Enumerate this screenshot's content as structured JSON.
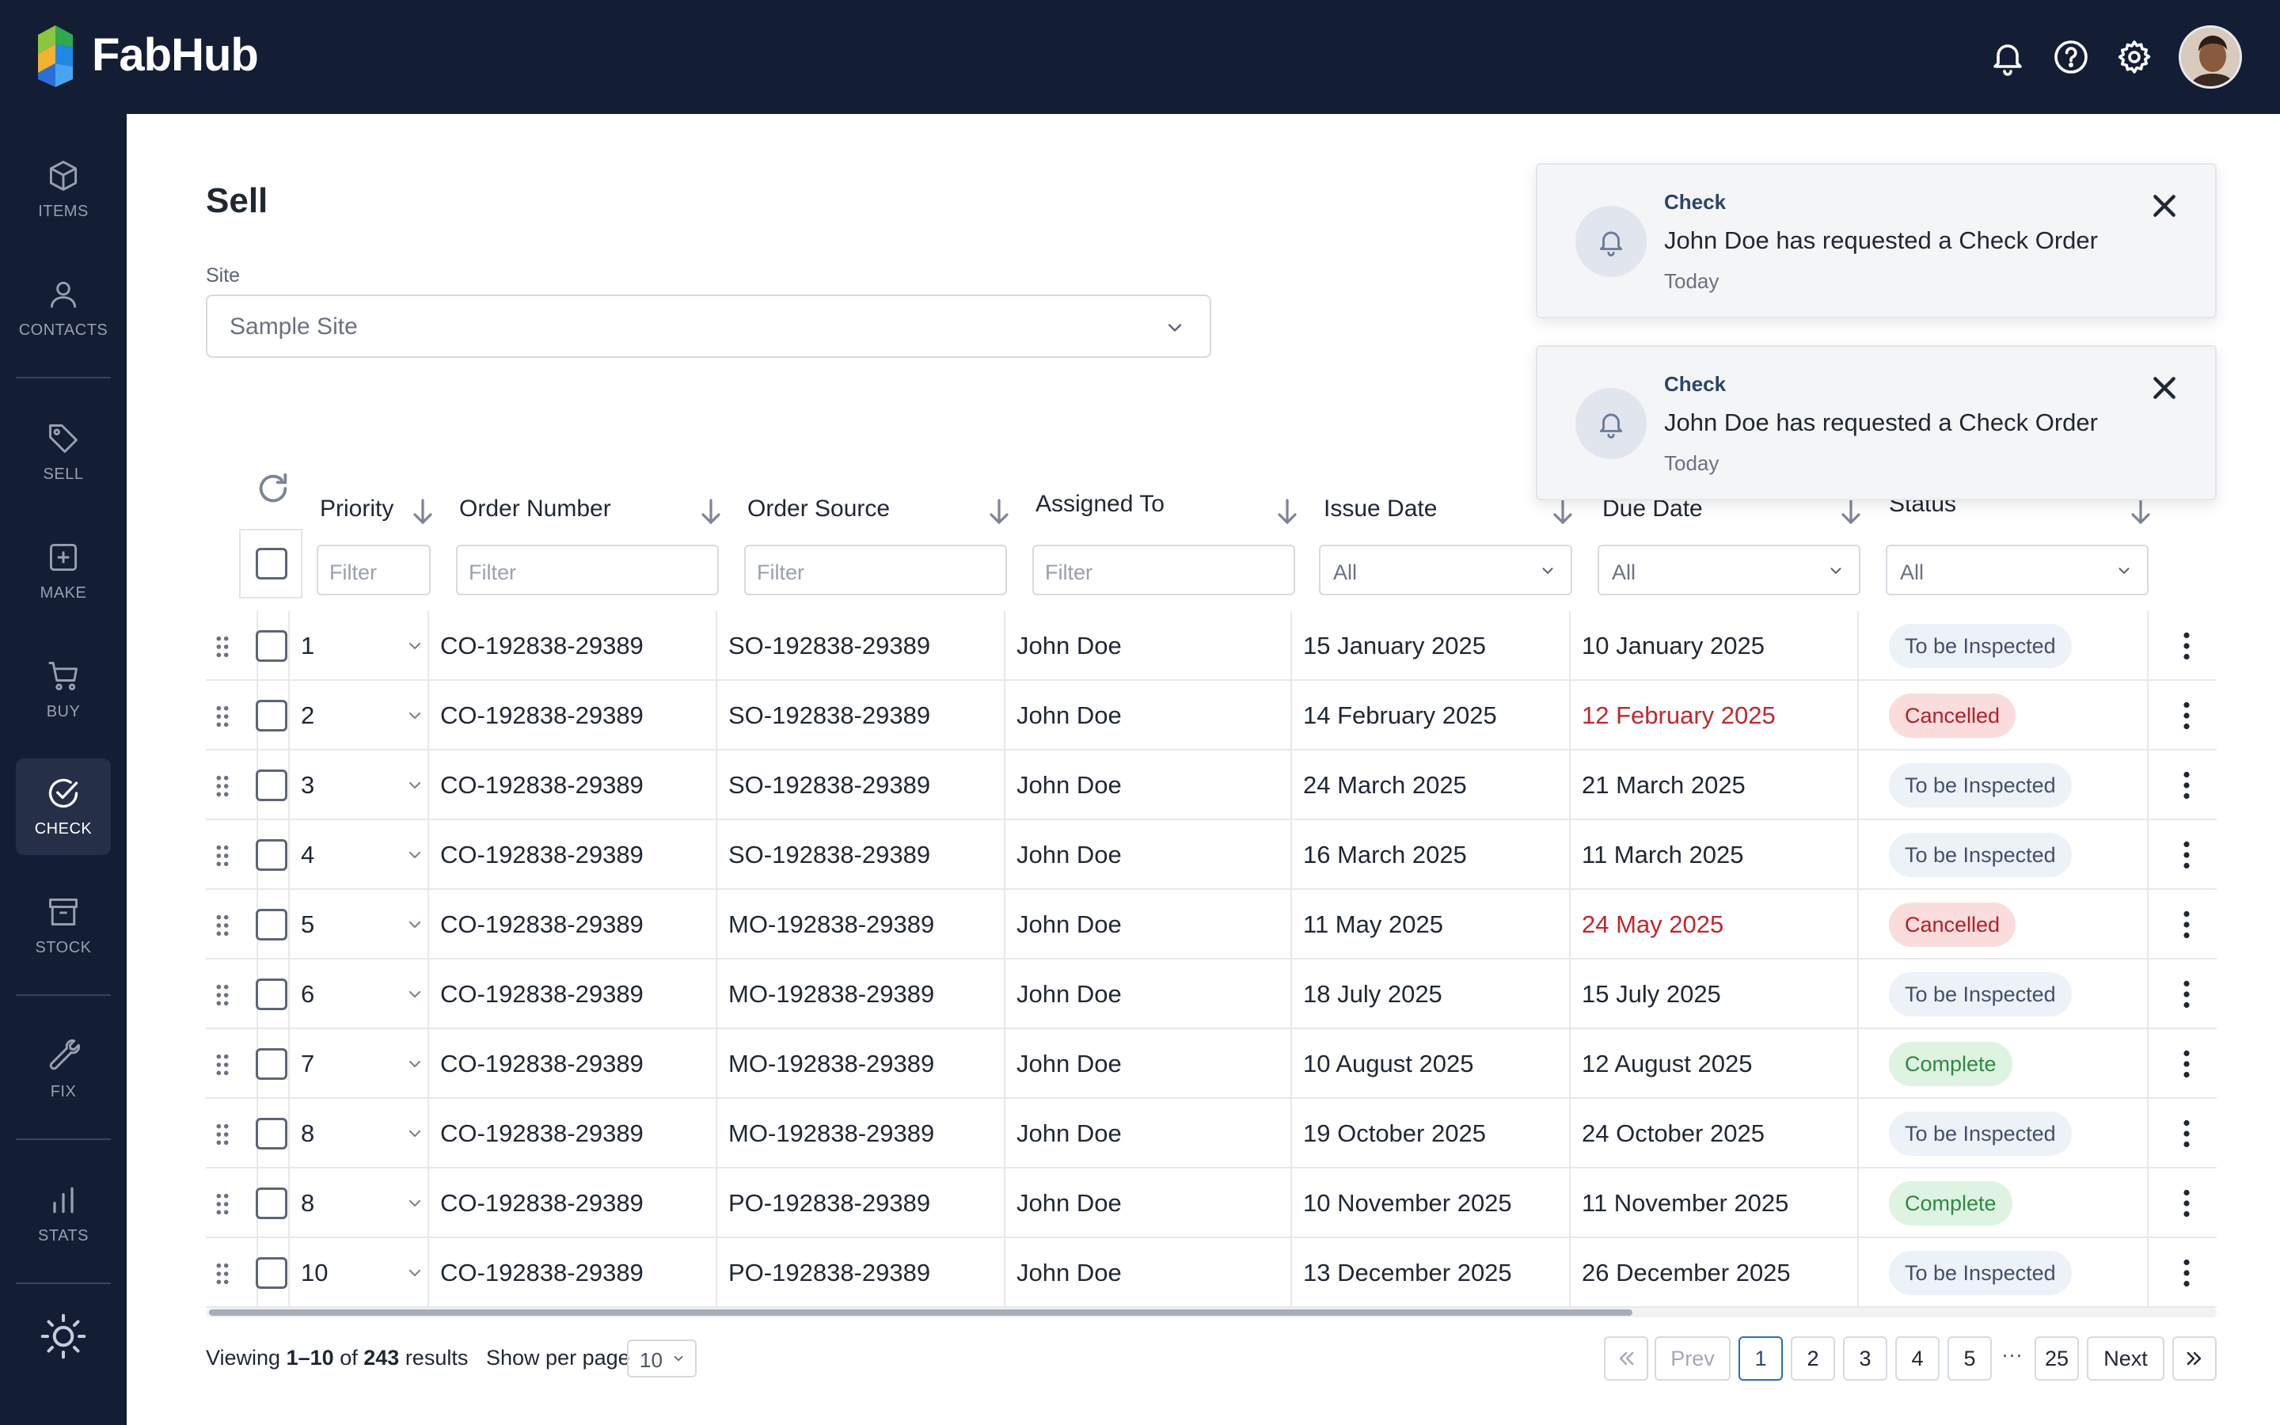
{
  "app": {
    "brand": "FabHub"
  },
  "topbar": {
    "icons": [
      "bell-icon",
      "help-icon",
      "gear-icon"
    ]
  },
  "sidebar": {
    "items": [
      {
        "label": "ITEMS",
        "icon": "cube-icon"
      },
      {
        "label": "CONTACTS",
        "icon": "person-icon"
      },
      {
        "label": "SELL",
        "icon": "tag-icon"
      },
      {
        "label": "MAKE",
        "icon": "plus-square-icon"
      },
      {
        "label": "BUY",
        "icon": "cart-icon"
      },
      {
        "label": "CHECK",
        "icon": "check-circle-icon",
        "active": true
      },
      {
        "label": "STOCK",
        "icon": "archive-icon"
      },
      {
        "label": "FIX",
        "icon": "wrench-icon"
      },
      {
        "label": "STATS",
        "icon": "bar-chart-icon"
      }
    ]
  },
  "page": {
    "title": "Sell",
    "site_label": "Site",
    "site_value": "Sample Site"
  },
  "table": {
    "columns": [
      "Priority",
      "Order Number",
      "Order Source",
      "Assigned To",
      "Issue Date",
      "Due Date",
      "Status"
    ],
    "filters": {
      "text_placeholder": "Filter",
      "select_value": "All"
    },
    "rows": [
      {
        "priority": "1",
        "order": "CO-192838-29389",
        "source": "SO-192838-29389",
        "assigned": "John Doe",
        "issue": "15 January 2025",
        "due": "10 January 2025",
        "due_overdue": false,
        "status": "To be Inspected",
        "status_kind": "inspect"
      },
      {
        "priority": "2",
        "order": "CO-192838-29389",
        "source": "SO-192838-29389",
        "assigned": "John Doe",
        "issue": "14 February 2025",
        "due": "12 February 2025",
        "due_overdue": true,
        "status": "Cancelled",
        "status_kind": "cancel"
      },
      {
        "priority": "3",
        "order": "CO-192838-29389",
        "source": "SO-192838-29389",
        "assigned": "John Doe",
        "issue": "24 March 2025",
        "due": "21 March 2025",
        "due_overdue": false,
        "status": "To be Inspected",
        "status_kind": "inspect"
      },
      {
        "priority": "4",
        "order": "CO-192838-29389",
        "source": "SO-192838-29389",
        "assigned": "John Doe",
        "issue": "16 March 2025",
        "due": "11 March 2025",
        "due_overdue": false,
        "status": "To be Inspected",
        "status_kind": "inspect"
      },
      {
        "priority": "5",
        "order": "CO-192838-29389",
        "source": "MO-192838-29389",
        "assigned": "John Doe",
        "issue": "11 May 2025",
        "due": "24 May 2025",
        "due_overdue": true,
        "status": "Cancelled",
        "status_kind": "cancel"
      },
      {
        "priority": "6",
        "order": "CO-192838-29389",
        "source": "MO-192838-29389",
        "assigned": "John Doe",
        "issue": "18 July 2025",
        "due": "15 July 2025",
        "due_overdue": false,
        "status": "To be Inspected",
        "status_kind": "inspect"
      },
      {
        "priority": "7",
        "order": "CO-192838-29389",
        "source": "MO-192838-29389",
        "assigned": "John Doe",
        "issue": "10 August 2025",
        "due": "12 August 2025",
        "due_overdue": false,
        "status": "Complete",
        "status_kind": "complete"
      },
      {
        "priority": "8",
        "order": "CO-192838-29389",
        "source": "MO-192838-29389",
        "assigned": "John Doe",
        "issue": "19 October 2025",
        "due": "24 October 2025",
        "due_overdue": false,
        "status": "To be Inspected",
        "status_kind": "inspect"
      },
      {
        "priority": "8",
        "order": "CO-192838-29389",
        "source": "PO-192838-29389",
        "assigned": "John Doe",
        "issue": "10 November 2025",
        "due": "11 November 2025",
        "due_overdue": false,
        "status": "Complete",
        "status_kind": "complete"
      },
      {
        "priority": "10",
        "order": "CO-192838-29389",
        "source": "PO-192838-29389",
        "assigned": "John Doe",
        "issue": "13 December 2025",
        "due": "26 December 2025",
        "due_overdue": false,
        "status": "To be Inspected",
        "status_kind": "inspect"
      }
    ]
  },
  "footer": {
    "viewing_prefix": "Viewing",
    "viewing_range": "1–10",
    "viewing_of": "of",
    "viewing_total": "243",
    "viewing_suffix": "results",
    "per_page_label": "Show per page",
    "per_page_value": "10"
  },
  "pagination": {
    "prev": "Prev",
    "next": "Next",
    "pages": [
      "1",
      "2",
      "3",
      "4",
      "5"
    ],
    "last": "25",
    "ellipsis": "···",
    "current": "1"
  },
  "toasts": [
    {
      "category": "Check",
      "message": "John Doe has requested a Check Order",
      "time": "Today"
    },
    {
      "category": "Check",
      "message": "John Doe has requested a Check Order",
      "time": "Today"
    }
  ],
  "colors": {
    "nav_bg": "#131d33",
    "overdue": "#c1272d",
    "badge_inspect": "#edf1f8",
    "badge_cancel": "#fbdcdc",
    "badge_complete": "#dff3e2"
  }
}
